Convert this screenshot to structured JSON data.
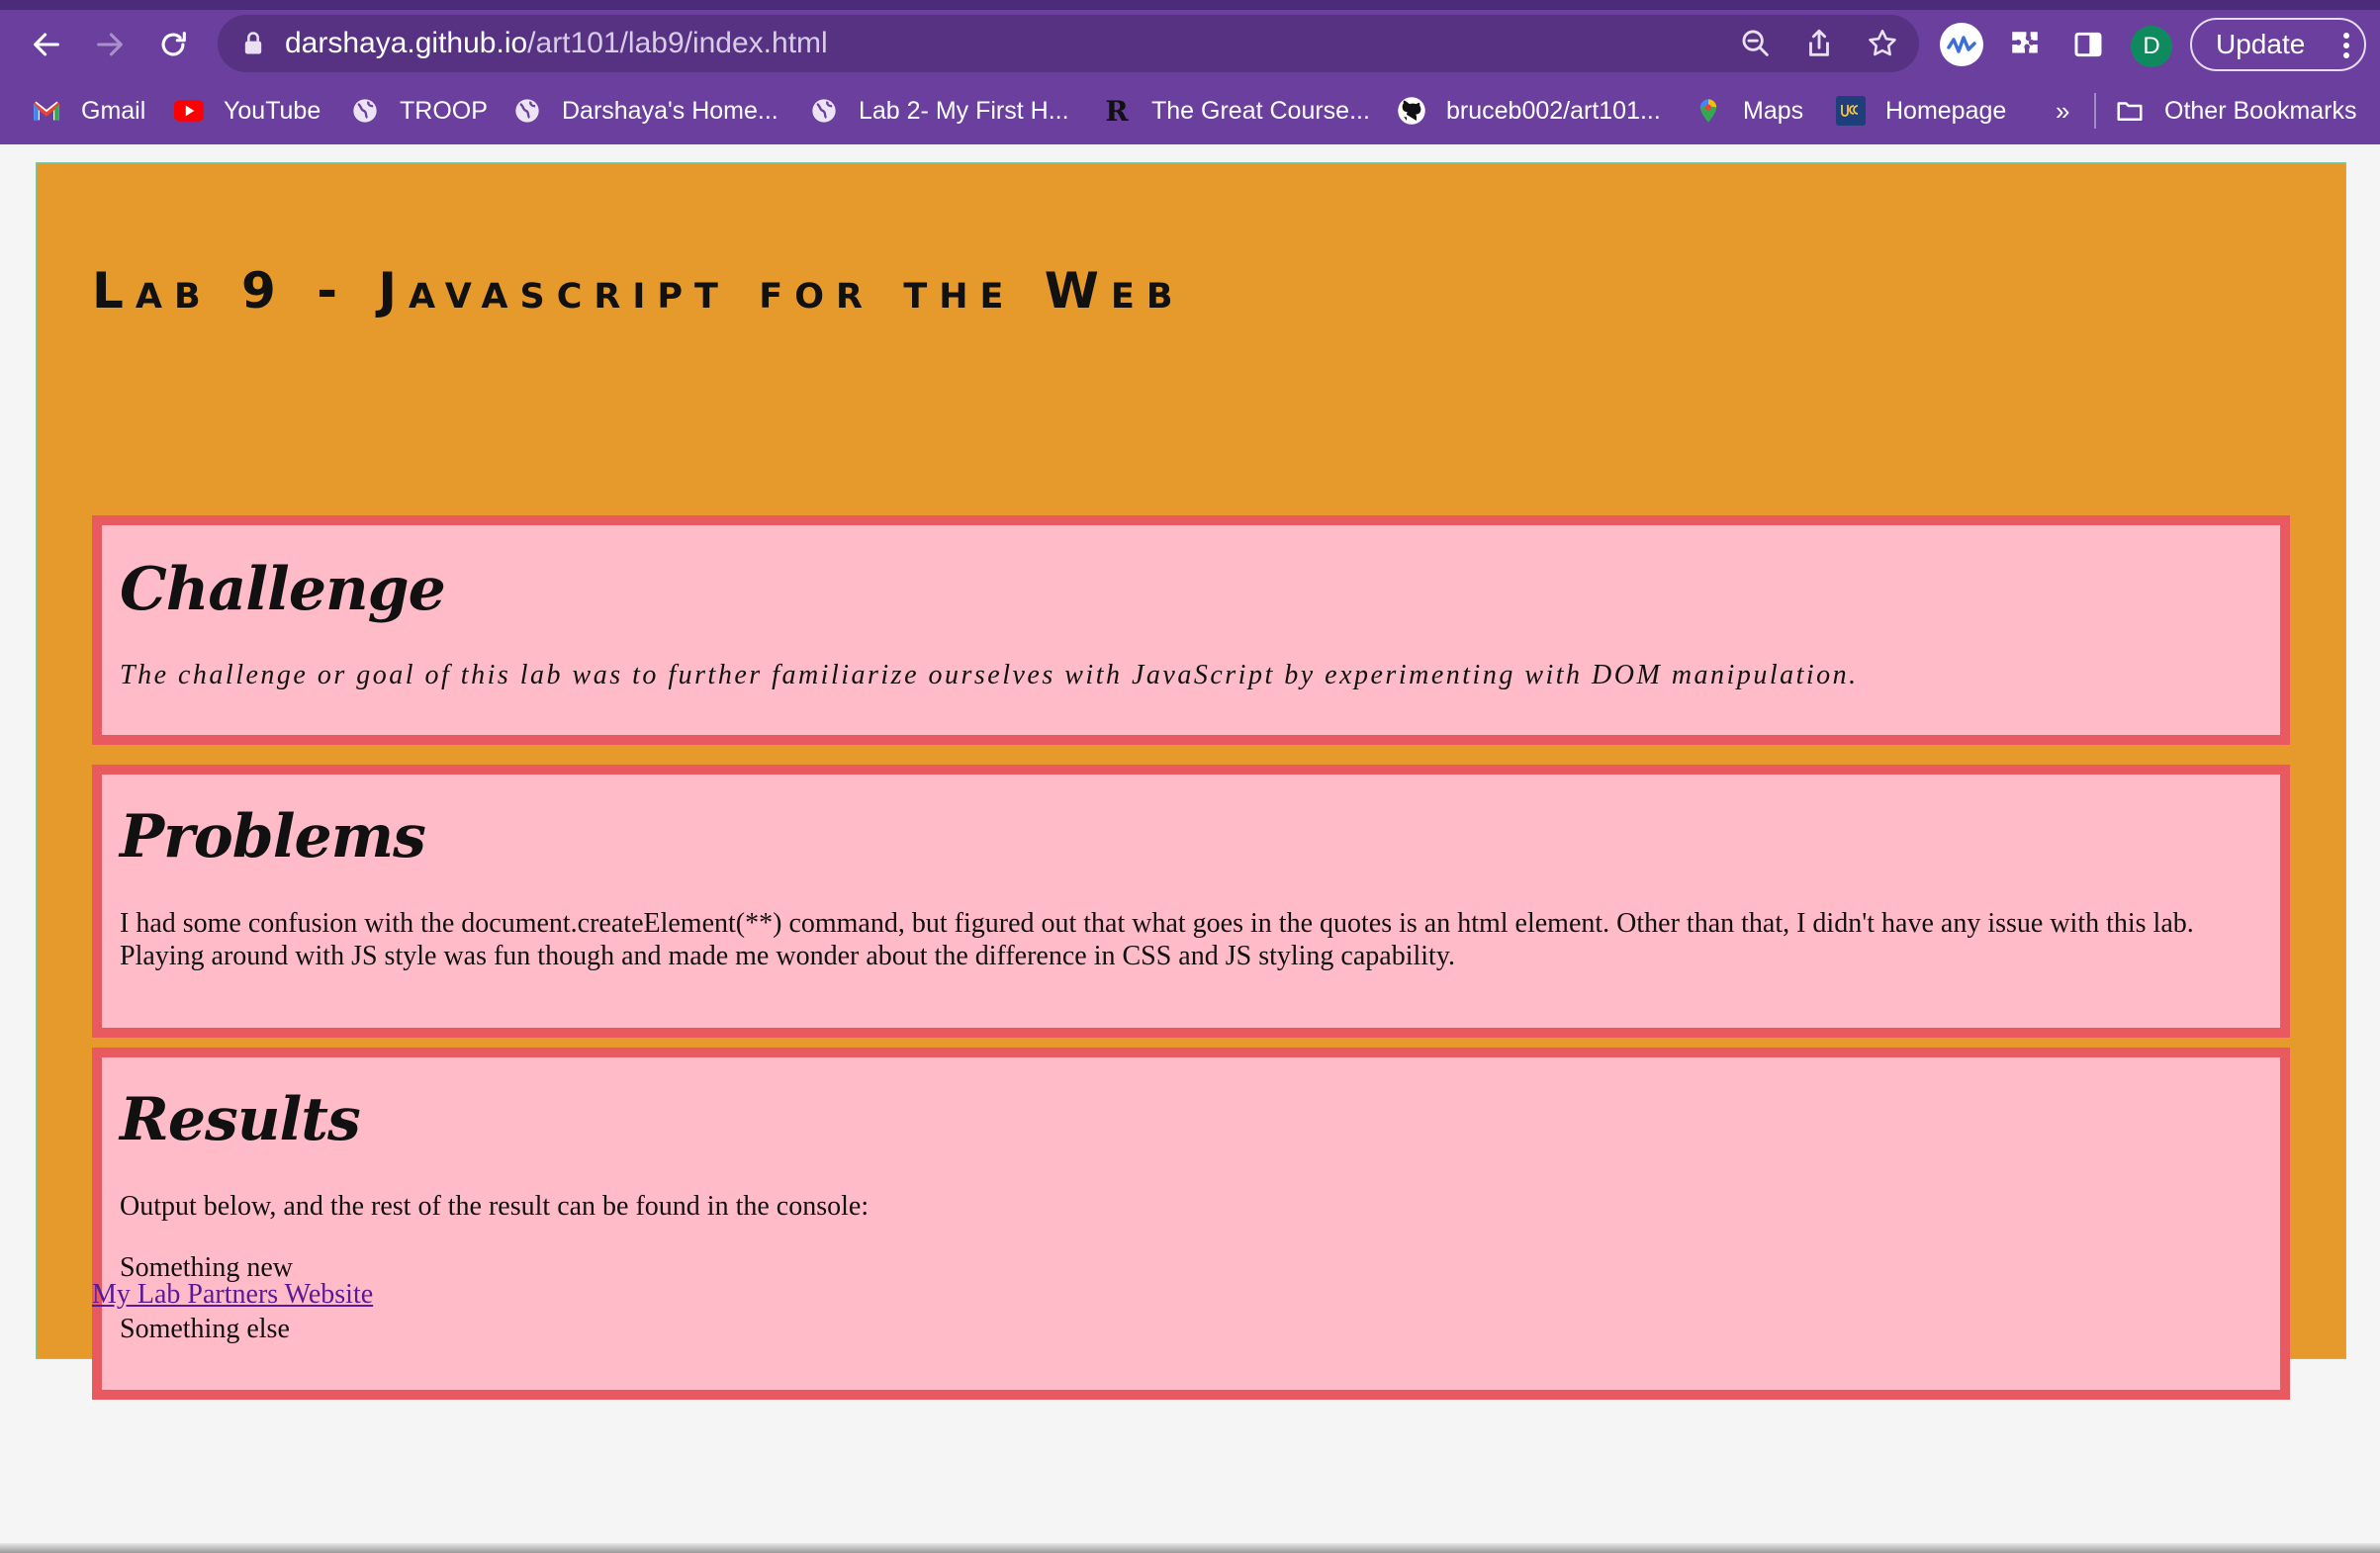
{
  "browser": {
    "url_host": "darshaya.github.io",
    "url_path": "/art101/lab9/index.html",
    "profile_initial": "D",
    "update_label": "Update",
    "bookmarks": [
      {
        "label": "Gmail",
        "icon": "gmail-icon"
      },
      {
        "label": "YouTube",
        "icon": "youtube-icon"
      },
      {
        "label": "TROOP",
        "icon": "globe-icon"
      },
      {
        "label": "Darshaya's Home...",
        "icon": "globe-icon"
      },
      {
        "label": "Lab 2- My First H...",
        "icon": "globe-icon"
      },
      {
        "label": "The Great Course...",
        "icon": "r-logo-icon"
      },
      {
        "label": "bruceb002/art101...",
        "icon": "github-icon"
      },
      {
        "label": "Maps",
        "icon": "maps-pin-icon"
      },
      {
        "label": "Homepage",
        "icon": "ucsc-icon"
      }
    ],
    "overflow_label": "»",
    "other_bookmarks_label": "Other Bookmarks",
    "colors": {
      "frame": "#6a3f9e",
      "omnibox": "#573282"
    }
  },
  "page": {
    "title": "Lab 9 - Javascript for the Web",
    "sections": {
      "challenge": {
        "heading": "Challenge",
        "text": "The challenge or goal of this lab was to further familiarize ourselves with JavaScript by experimenting with DOM manipulation."
      },
      "problems": {
        "heading": "Problems",
        "text": "I had some confusion with the document.createElement(**) command, but figured out that what goes in the quotes is an html element. Other than that, I didn't have any issue with this lab. Playing around with JS style was fun though and made me wonder about the difference in CSS and JS styling capability."
      },
      "results": {
        "heading": "Results",
        "intro": "Output below, and the rest of the result can be found in the console:",
        "outputs": [
          "Something new",
          "Something else"
        ]
      }
    },
    "partner_link": "My Lab Partners Website",
    "colors": {
      "background": "#e69a2b",
      "panel": "#ffbcc8",
      "panel_border": "#e85a60"
    }
  }
}
